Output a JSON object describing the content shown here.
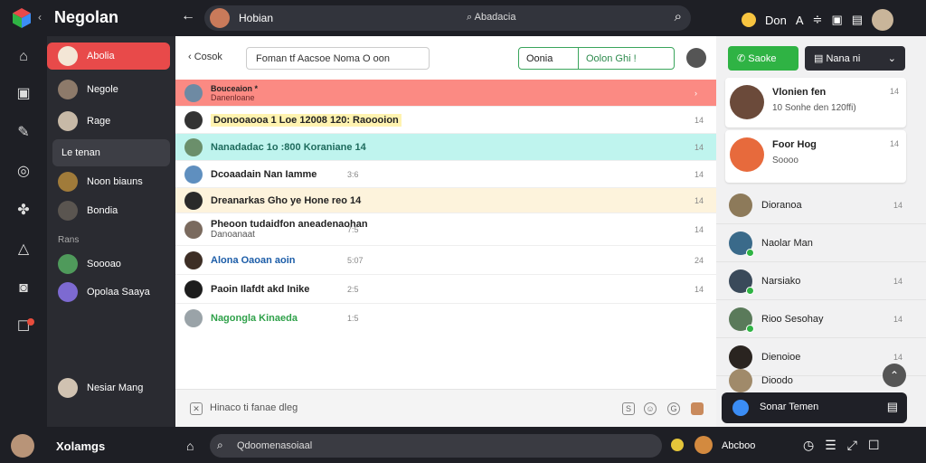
{
  "app": {
    "brand": "Negolan"
  },
  "topbar": {
    "chat_name": "Hobian",
    "search": "Abadacia",
    "right_label": "Don"
  },
  "left": {
    "items": [
      {
        "label": "Abolia"
      },
      {
        "label": "Negole"
      },
      {
        "label": "Rage"
      },
      {
        "label": "Le tenan"
      },
      {
        "label": "Noon biauns"
      },
      {
        "label": "Bondia"
      },
      {
        "label": "Soooao"
      },
      {
        "label": "Opolaa Saaya"
      },
      {
        "label": "Nesiar Mang"
      }
    ],
    "section": "Rans"
  },
  "main": {
    "back": "Cosok",
    "field": "Foman  tf  Aacsoe Noma  O  oon",
    "dual_left": "Oonia",
    "dual_right": "Oolon Ghi !",
    "messages": [
      {
        "text": "Bouceaion *",
        "sub": "Danenloane",
        "time": ""
      },
      {
        "text": "Donooaooa 1 Loe 12008 120: Raoooion",
        "time": "14"
      },
      {
        "text": "Nanadadac 1o :800  Koraniane 14",
        "time": "14"
      },
      {
        "text": "Dcoaadain Nan  Iamme",
        "time2": "3:6",
        "time": "14"
      },
      {
        "text": "Dreanarkas Gho ye Hone reo 14",
        "time": "14"
      },
      {
        "text": "Pheoon tudaidfon aneadenaohan",
        "sub": "Danoanaat",
        "time2": "7:5",
        "time": "14"
      },
      {
        "text": "Alona  Oaoan aoin",
        "time2": "5:07",
        "time": "24"
      },
      {
        "text": "Paoin Ilafdt akd Inike",
        "time2": "2:5",
        "time": "14"
      },
      {
        "text": "Nagongla Kinaeda",
        "time2": "1:5",
        "time": ""
      }
    ],
    "compose_placeholder": "Hinaco ti fanae dleg"
  },
  "right": {
    "btn_green": "Saoke",
    "btn_dark": "Nana ni",
    "cards": [
      {
        "title": "Vlonien fen",
        "sub": "10 Sonhe den 120ffi)",
        "x": "14"
      },
      {
        "title": "Foor Hog",
        "sub": "Soooo",
        "x": "14"
      }
    ],
    "rows": [
      {
        "label": "Dioranoa",
        "x": "14"
      },
      {
        "label": "Naolar Man",
        "x": ""
      },
      {
        "label": "Narsiako",
        "x": "14"
      },
      {
        "label": "Rioo Sesohay",
        "x": "14"
      },
      {
        "label": "Dienoioe",
        "x": "14"
      },
      {
        "label": "Dioodo",
        "x": ""
      }
    ],
    "bar_label": "Sonar Temen"
  },
  "bottom": {
    "name": "Xolamgs",
    "search": "Qdoomenasoiaal",
    "right_label": "Abcboo"
  },
  "colors": {
    "accent": "#e84a4a",
    "green": "#2fb344",
    "dark": "#1e1f25"
  }
}
